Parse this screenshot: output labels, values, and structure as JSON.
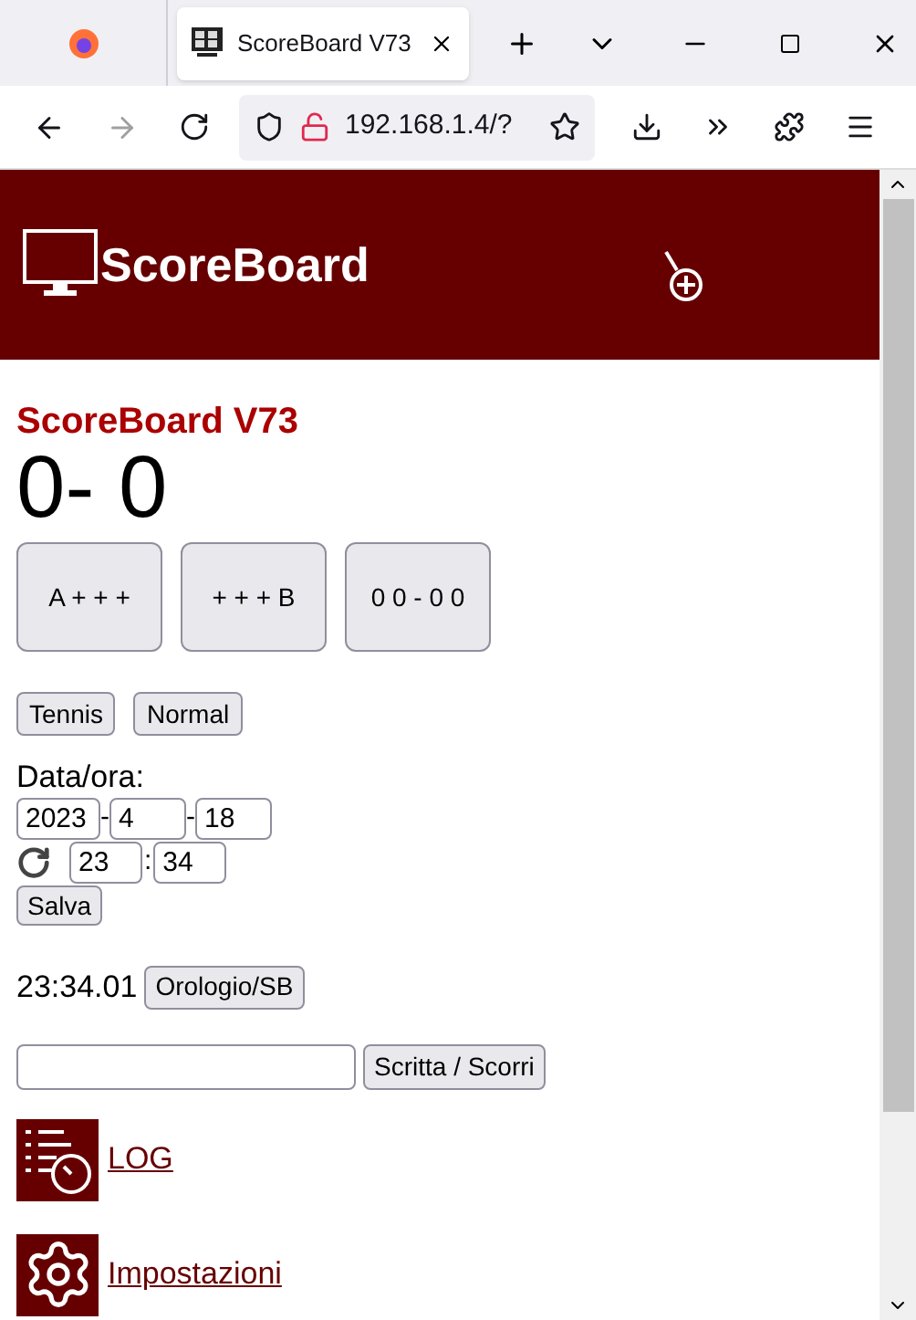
{
  "browser": {
    "tab_title": "ScoreBoard V73",
    "url": "192.168.1.4/?"
  },
  "header": {
    "title": "ScoreBoard"
  },
  "heading": "ScoreBoard V73",
  "score": "0- 0",
  "score_buttons": [
    "A + + +",
    "+ + + B",
    "0 0 - 0 0"
  ],
  "mode_buttons": [
    "Tennis",
    "Normal"
  ],
  "datetime": {
    "label": "Data/ora:",
    "year": "2023",
    "sep1": "-",
    "month": "4",
    "sep2": "-",
    "day": "18",
    "hour": "23",
    "sep3": ":",
    "minute": "34",
    "save": "Salva"
  },
  "clock": {
    "time": "23:34.01",
    "button": "Orologio/SB"
  },
  "message": {
    "button": "Scritta / Scorri"
  },
  "links": [
    {
      "kind": "log",
      "label": "LOG"
    },
    {
      "kind": "settings",
      "label": "Impostazioni"
    }
  ]
}
